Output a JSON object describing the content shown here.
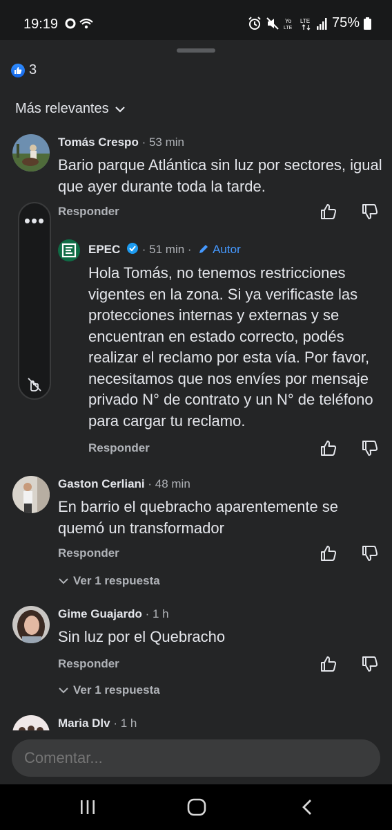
{
  "status": {
    "time": "19:19",
    "battery": "75%",
    "icons_left": [
      "o-icon",
      "wifi-icon"
    ],
    "icons_right": [
      "alarm-icon",
      "mute-icon",
      "volte-icon",
      "lte-icon",
      "signal-icon",
      "battery-icon"
    ],
    "volte_label": "Yo\nLTE",
    "lte_label": "LTE"
  },
  "reactions": {
    "count": "3",
    "icon": "like-icon",
    "color": "#1877f2"
  },
  "sort": {
    "label": "Más relevantes"
  },
  "comments": [
    {
      "name": "Tomás Crespo",
      "time": "· 53 min",
      "text": "Bario parque Atlántica sin luz por sectores, igual que ayer durante toda la tarde.",
      "reply_label": "Responder"
    },
    {
      "name": "Gaston Cerliani",
      "time": "· 48 min",
      "text": "En barrio el quebracho aparentemente se quemó un transformador",
      "reply_label": "Responder",
      "view_replies": "Ver 1 respuesta"
    },
    {
      "name": "Gime Guajardo",
      "time": "· 1 h",
      "text": "Sin luz por el Quebracho",
      "reply_label": "Responder",
      "view_replies": "Ver 1 respuesta"
    },
    {
      "name": "Maria Dlv",
      "time": "· 1 h"
    }
  ],
  "reply": {
    "name": "EPEC",
    "time": "· 51 min ·",
    "author_tag": "Autor",
    "text": "Hola Tomás, no tenemos restricciones vigentes en la zona. Si ya verificaste las protecciones internas y externas y se encuentran en estado correcto, podés realizar el reclamo por esta vía. Por favor, necesitamos que nos envíes por mensaje privado N° de contrato y un N° de teléfono para cargar tu reclamo.",
    "reply_label": "Responder",
    "brand_color": "#0f6b45"
  },
  "floating_panel": {
    "more_label": "•••"
  },
  "composer": {
    "placeholder": "Comentar..."
  },
  "nav": {
    "icons": [
      "recents-icon",
      "home-icon",
      "back-icon"
    ]
  }
}
